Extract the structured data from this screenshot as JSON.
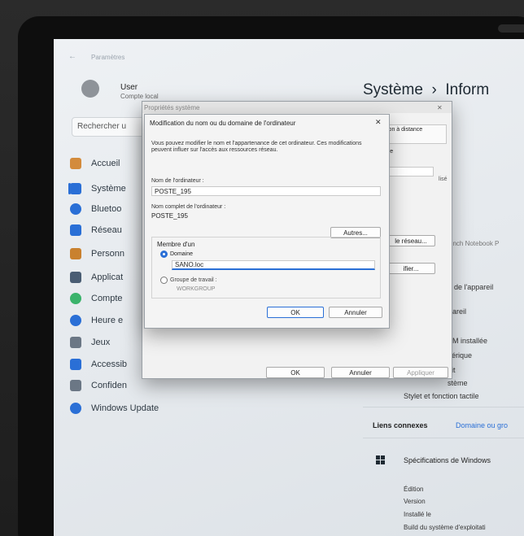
{
  "settings": {
    "back_arrow": "←",
    "title": "Paramètres",
    "user_name": "User",
    "user_subtitle": "Compte local",
    "search_placeholder": "Rechercher u",
    "nav": [
      {
        "label": "Accueil",
        "icon": "home-icon",
        "color": "#d38b3c"
      },
      {
        "label": "Système",
        "icon": "system-icon",
        "color": "#2a6fd6"
      },
      {
        "label": "Bluetoo",
        "icon": "bluetooth-icon",
        "color": "#2a6fd6"
      },
      {
        "label": "Réseau",
        "icon": "network-icon",
        "color": "#2a6fd6"
      },
      {
        "label": "Personn",
        "icon": "personalization-icon",
        "color": "#c9812e"
      },
      {
        "label": "Applicat",
        "icon": "apps-icon",
        "color": "#4a5d73"
      },
      {
        "label": "Compte",
        "icon": "accounts-icon",
        "color": "#3bb36b"
      },
      {
        "label": "Heure e",
        "icon": "time-icon",
        "color": "#2a6fd6"
      },
      {
        "label": "Jeux",
        "icon": "gaming-icon",
        "color": "#6b7785"
      },
      {
        "label": "Accessib",
        "icon": "accessibility-icon",
        "color": "#2a6fd6"
      },
      {
        "label": "Confiden",
        "icon": "privacy-icon",
        "color": "#6b7785"
      },
      {
        "label": "Windows Update",
        "icon": "windows-update-icon",
        "color": "#2a6fd6"
      }
    ],
    "page_title": "Système  ›  Inform",
    "right_items": {
      "device_partial": "V",
      "device_model": "6 inch Notebook P",
      "device_specs": "ns de l'appareil",
      "appareil": "ppareil",
      "ram": "AM installée",
      "peripherique": "hérique",
      "uit": "uit",
      "systeme": "stème",
      "stylet": "Stylet et fonction tactile",
      "liens_connexes": "Liens connexes",
      "domaine_link": "Domaine ou gro",
      "win_specs": "Spécifications de Windows",
      "edition": "Édition",
      "version": "Version",
      "installe": "Installé le",
      "build": "Build du système d'exploitati"
    }
  },
  "system_properties": {
    "title": "Propriétés système",
    "close": "✕",
    "tab_remote": "ion à distance",
    "remote_partial": "l",
    "tre": "tre",
    "lise": "lisé",
    "reseau_btn": "le réseau...",
    "fier_btn": "ifier...",
    "ok": "OK",
    "annuler": "Annuler",
    "appliquer": "Appliquer"
  },
  "rename_dialog": {
    "title": "Modification du nom ou du domaine de l'ordinateur",
    "close": "✕",
    "intro": "Vous pouvez modifier le nom et l'appartenance de cet ordinateur. Ces modifications peuvent influer sur l'accès aux ressources réseau.",
    "computer_name_label": "Nom de l'ordinateur :",
    "computer_name_value": "POSTE_195",
    "full_name_label": "Nom complet de l'ordinateur :",
    "full_name_value": "POSTE_195",
    "autres_btn": "Autres...",
    "member_of": "Membre d'un",
    "domain_label": "Domaine",
    "domain_value": "SANO.loc",
    "workgroup_label": "Groupe de travail :",
    "workgroup_value": "WORKGROUP",
    "ok": "OK",
    "cancel": "Annuler"
  }
}
